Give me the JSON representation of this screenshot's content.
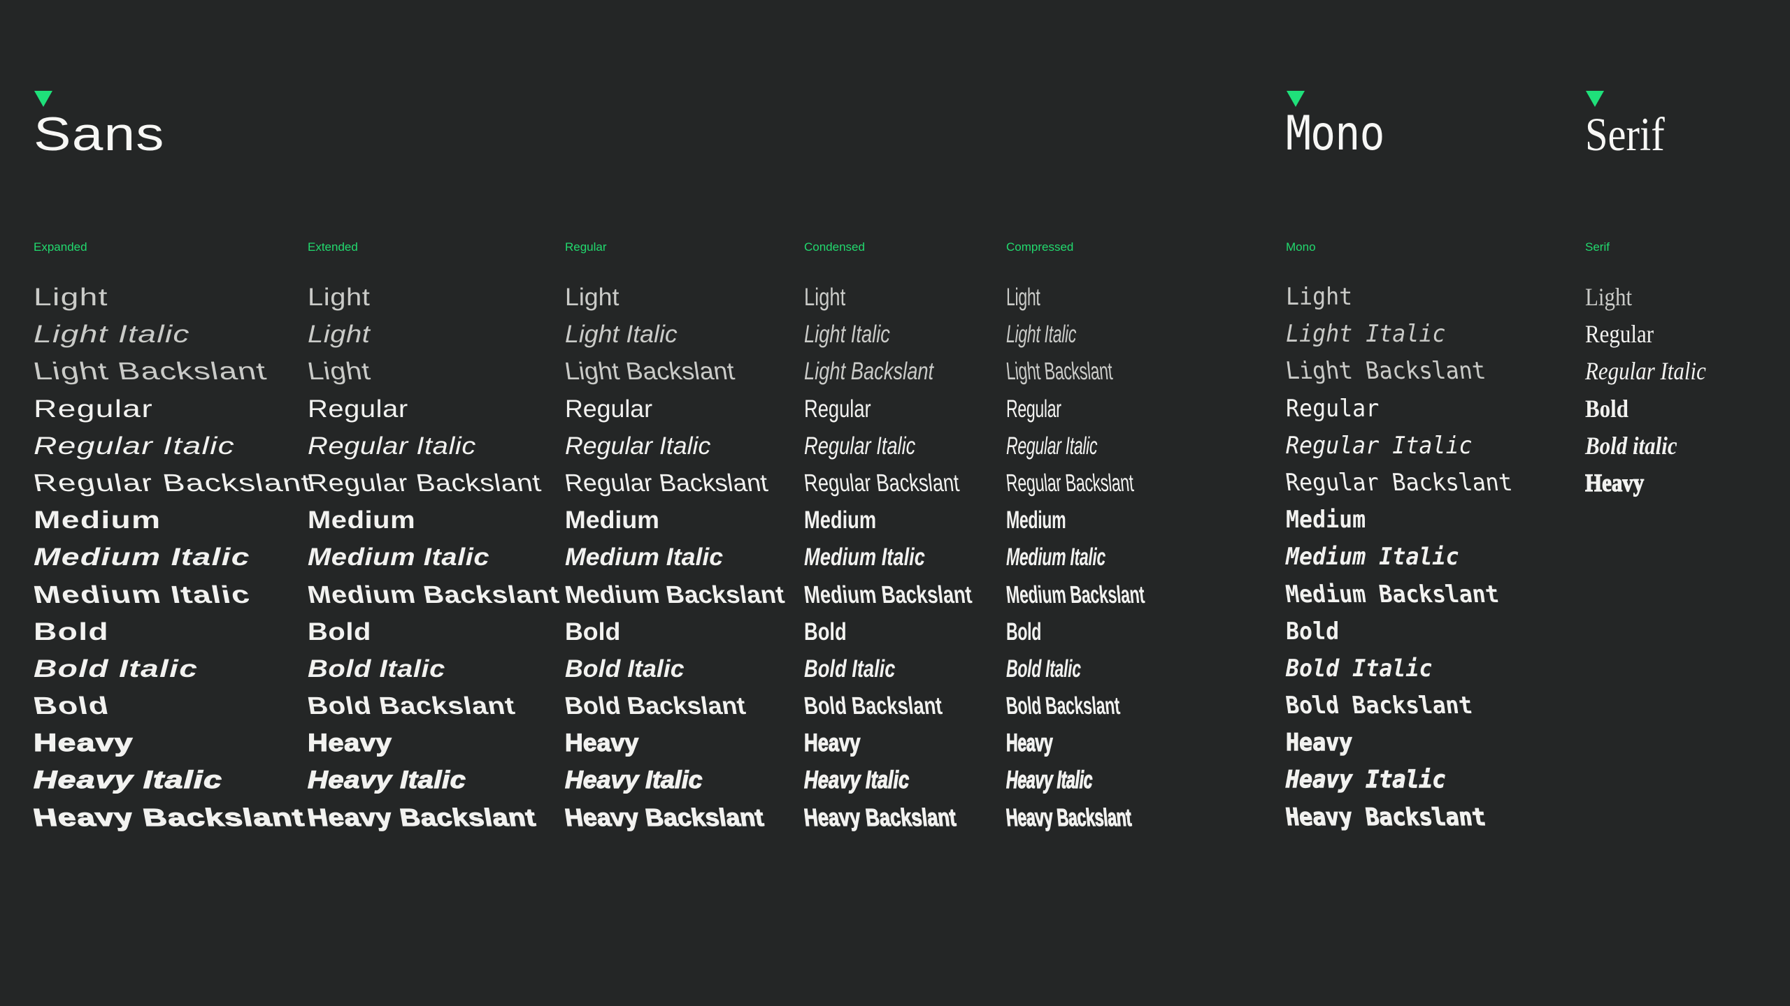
{
  "accent_color": "#1fe07a",
  "background_color": "#242626",
  "families": [
    {
      "id": "sans",
      "heading": "Sans",
      "marker_icon": "triangle-down-icon",
      "columns": [
        {
          "id": "expanded",
          "label": "Expanded",
          "rows": [
            {
              "text": "Light",
              "weight": "light",
              "slant": "upright"
            },
            {
              "text": "Light Italic",
              "weight": "light",
              "slant": "italic"
            },
            {
              "text": "Light Backslant",
              "weight": "light",
              "slant": "backslant"
            },
            {
              "text": "Regular",
              "weight": "regular",
              "slant": "upright"
            },
            {
              "text": "Regular Italic",
              "weight": "regular",
              "slant": "italic"
            },
            {
              "text": "Regular Backslant",
              "weight": "regular",
              "slant": "backslant"
            },
            {
              "text": "Medium",
              "weight": "medium",
              "slant": "upright"
            },
            {
              "text": "Medium Italic",
              "weight": "medium",
              "slant": "italic"
            },
            {
              "text": "Medium Italic",
              "weight": "medium",
              "slant": "backslant"
            },
            {
              "text": "Bold",
              "weight": "bold",
              "slant": "upright"
            },
            {
              "text": "Bold Italic",
              "weight": "bold",
              "slant": "italic"
            },
            {
              "text": "Bold",
              "weight": "bold",
              "slant": "backslant"
            },
            {
              "text": "Heavy",
              "weight": "heavy",
              "slant": "upright"
            },
            {
              "text": "Heavy Italic",
              "weight": "heavy",
              "slant": "italic"
            },
            {
              "text": "Heavy Backslant",
              "weight": "heavy",
              "slant": "backslant"
            }
          ]
        },
        {
          "id": "extended",
          "label": "Extended",
          "rows": [
            {
              "text": "Light",
              "weight": "light",
              "slant": "upright"
            },
            {
              "text": "Light",
              "weight": "light",
              "slant": "italic"
            },
            {
              "text": "Light",
              "weight": "light",
              "slant": "backslant"
            },
            {
              "text": "Regular",
              "weight": "regular",
              "slant": "upright"
            },
            {
              "text": "Regular Italic",
              "weight": "regular",
              "slant": "italic"
            },
            {
              "text": "Regular Backslant",
              "weight": "regular",
              "slant": "backslant"
            },
            {
              "text": "Medium",
              "weight": "medium",
              "slant": "upright"
            },
            {
              "text": "Medium Italic",
              "weight": "medium",
              "slant": "italic"
            },
            {
              "text": "Medium Backslant",
              "weight": "medium",
              "slant": "backslant"
            },
            {
              "text": "Bold",
              "weight": "bold",
              "slant": "upright"
            },
            {
              "text": "Bold Italic",
              "weight": "bold",
              "slant": "italic"
            },
            {
              "text": "Bold Backslant",
              "weight": "bold",
              "slant": "backslant"
            },
            {
              "text": "Heavy",
              "weight": "heavy",
              "slant": "upright"
            },
            {
              "text": "Heavy Italic",
              "weight": "heavy",
              "slant": "italic"
            },
            {
              "text": "Heavy Backslant",
              "weight": "heavy",
              "slant": "backslant"
            }
          ]
        },
        {
          "id": "regular",
          "label": "Regular",
          "rows": [
            {
              "text": "Light",
              "weight": "light",
              "slant": "upright"
            },
            {
              "text": "Light Italic",
              "weight": "light",
              "slant": "italic"
            },
            {
              "text": "Light Backslant",
              "weight": "light",
              "slant": "backslant"
            },
            {
              "text": "Regular",
              "weight": "regular",
              "slant": "upright"
            },
            {
              "text": "Regular Italic",
              "weight": "regular",
              "slant": "italic"
            },
            {
              "text": "Regular Backslant",
              "weight": "regular",
              "slant": "backslant"
            },
            {
              "text": "Medium",
              "weight": "medium",
              "slant": "upright"
            },
            {
              "text": "Medium Italic",
              "weight": "medium",
              "slant": "italic"
            },
            {
              "text": "Medium Backslant",
              "weight": "medium",
              "slant": "backslant"
            },
            {
              "text": "Bold",
              "weight": "bold",
              "slant": "upright"
            },
            {
              "text": "Bold Italic",
              "weight": "bold",
              "slant": "italic"
            },
            {
              "text": "Bold Backslant",
              "weight": "bold",
              "slant": "backslant"
            },
            {
              "text": "Heavy",
              "weight": "heavy",
              "slant": "upright"
            },
            {
              "text": "Heavy Italic",
              "weight": "heavy",
              "slant": "italic"
            },
            {
              "text": "Heavy Backslant",
              "weight": "heavy",
              "slant": "backslant"
            }
          ]
        },
        {
          "id": "condensed",
          "label": "Condensed",
          "rows": [
            {
              "text": "Light",
              "weight": "light",
              "slant": "upright"
            },
            {
              "text": "Light Italic",
              "weight": "light",
              "slant": "italic"
            },
            {
              "text": "Light Backslant",
              "weight": "light",
              "slant": "italic"
            },
            {
              "text": "Regular",
              "weight": "regular",
              "slant": "upright"
            },
            {
              "text": "Regular Italic",
              "weight": "regular",
              "slant": "italic"
            },
            {
              "text": "Regular Backslant",
              "weight": "regular",
              "slant": "backslant"
            },
            {
              "text": "Medium",
              "weight": "medium",
              "slant": "upright"
            },
            {
              "text": "Medium Italic",
              "weight": "medium",
              "slant": "italic"
            },
            {
              "text": "Medium Backslant",
              "weight": "medium",
              "slant": "backslant"
            },
            {
              "text": "Bold",
              "weight": "bold",
              "slant": "upright"
            },
            {
              "text": "Bold Italic",
              "weight": "bold",
              "slant": "italic"
            },
            {
              "text": "Bold Backslant",
              "weight": "bold",
              "slant": "backslant"
            },
            {
              "text": "Heavy",
              "weight": "heavy",
              "slant": "upright"
            },
            {
              "text": "Heavy Italic",
              "weight": "heavy",
              "slant": "italic"
            },
            {
              "text": "Heavy Backslant",
              "weight": "heavy",
              "slant": "backslant"
            }
          ]
        },
        {
          "id": "compressed",
          "label": "Compressed",
          "rows": [
            {
              "text": "Light",
              "weight": "light",
              "slant": "upright"
            },
            {
              "text": "Light Italic",
              "weight": "light",
              "slant": "italic"
            },
            {
              "text": "Light Backslant",
              "weight": "light",
              "slant": "backslant"
            },
            {
              "text": "Regular",
              "weight": "regular",
              "slant": "upright"
            },
            {
              "text": "Regular Italic",
              "weight": "regular",
              "slant": "italic"
            },
            {
              "text": "Regular Backslant",
              "weight": "regular",
              "slant": "backslant"
            },
            {
              "text": "Medium",
              "weight": "medium",
              "slant": "upright"
            },
            {
              "text": "Medium Italic",
              "weight": "medium",
              "slant": "italic"
            },
            {
              "text": "Medium Backslant",
              "weight": "medium",
              "slant": "backslant"
            },
            {
              "text": "Bold",
              "weight": "bold",
              "slant": "upright"
            },
            {
              "text": "Bold Italic",
              "weight": "bold",
              "slant": "italic"
            },
            {
              "text": "Bold Backslant",
              "weight": "bold",
              "slant": "backslant"
            },
            {
              "text": "Heavy",
              "weight": "heavy",
              "slant": "upright"
            },
            {
              "text": "Heavy Italic",
              "weight": "heavy",
              "slant": "italic"
            },
            {
              "text": "Heavy Backslant",
              "weight": "heavy",
              "slant": "backslant"
            }
          ]
        }
      ]
    },
    {
      "id": "mono",
      "heading": "Mono",
      "marker_icon": "triangle-down-icon",
      "columns": [
        {
          "id": "mono",
          "label": "Mono",
          "rows": [
            {
              "text": "Light",
              "weight": "light",
              "slant": "upright"
            },
            {
              "text": "Light Italic",
              "weight": "light",
              "slant": "italic"
            },
            {
              "text": "Light Backslant",
              "weight": "light",
              "slant": "backslant"
            },
            {
              "text": "Regular",
              "weight": "regular",
              "slant": "upright"
            },
            {
              "text": "Regular Italic",
              "weight": "regular",
              "slant": "italic"
            },
            {
              "text": "Regular Backslant",
              "weight": "regular",
              "slant": "backslant"
            },
            {
              "text": "Medium",
              "weight": "medium",
              "slant": "upright"
            },
            {
              "text": "Medium Italic",
              "weight": "medium",
              "slant": "italic"
            },
            {
              "text": "Medium Backslant",
              "weight": "medium",
              "slant": "backslant"
            },
            {
              "text": "Bold",
              "weight": "bold",
              "slant": "upright"
            },
            {
              "text": "Bold Italic",
              "weight": "bold",
              "slant": "italic"
            },
            {
              "text": "Bold Backslant",
              "weight": "bold",
              "slant": "backslant"
            },
            {
              "text": "Heavy",
              "weight": "heavy",
              "slant": "upright"
            },
            {
              "text": "Heavy Italic",
              "weight": "heavy",
              "slant": "italic"
            },
            {
              "text": "Heavy Backslant",
              "weight": "heavy",
              "slant": "backslant"
            }
          ]
        }
      ]
    },
    {
      "id": "serif",
      "heading": "Serif",
      "marker_icon": "triangle-down-icon",
      "columns": [
        {
          "id": "serif",
          "label": "Serif",
          "rows": [
            {
              "text": "Light",
              "weight": "light",
              "slant": "upright"
            },
            {
              "text": "Regular",
              "weight": "regular",
              "slant": "upright"
            },
            {
              "text": "Regular Italic",
              "weight": "regular",
              "slant": "italic"
            },
            {
              "text": "Bold",
              "weight": "bold",
              "slant": "upright"
            },
            {
              "text": "Bold italic",
              "weight": "bold",
              "slant": "italic"
            },
            {
              "text": "Heavy",
              "weight": "heavy",
              "slant": "upright"
            }
          ]
        }
      ]
    }
  ]
}
